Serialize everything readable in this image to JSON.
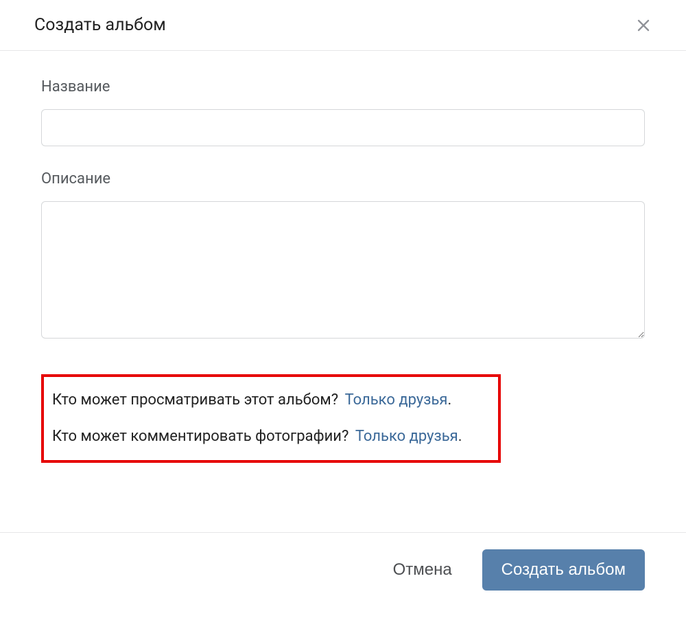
{
  "header": {
    "title": "Создать альбом"
  },
  "fields": {
    "name_label": "Название",
    "name_value": "",
    "desc_label": "Описание",
    "desc_value": ""
  },
  "privacy": {
    "view_question": "Кто может просматривать этот альбом?",
    "view_value": "Только друзья",
    "comment_question": "Кто может комментировать фотографии?",
    "comment_value": "Только друзья",
    "period": "."
  },
  "footer": {
    "cancel_label": "Отмена",
    "submit_label": "Создать альбом"
  },
  "colors": {
    "link": "#3a6898",
    "primary_button": "#5780ab",
    "highlight_border": "#e60000"
  }
}
